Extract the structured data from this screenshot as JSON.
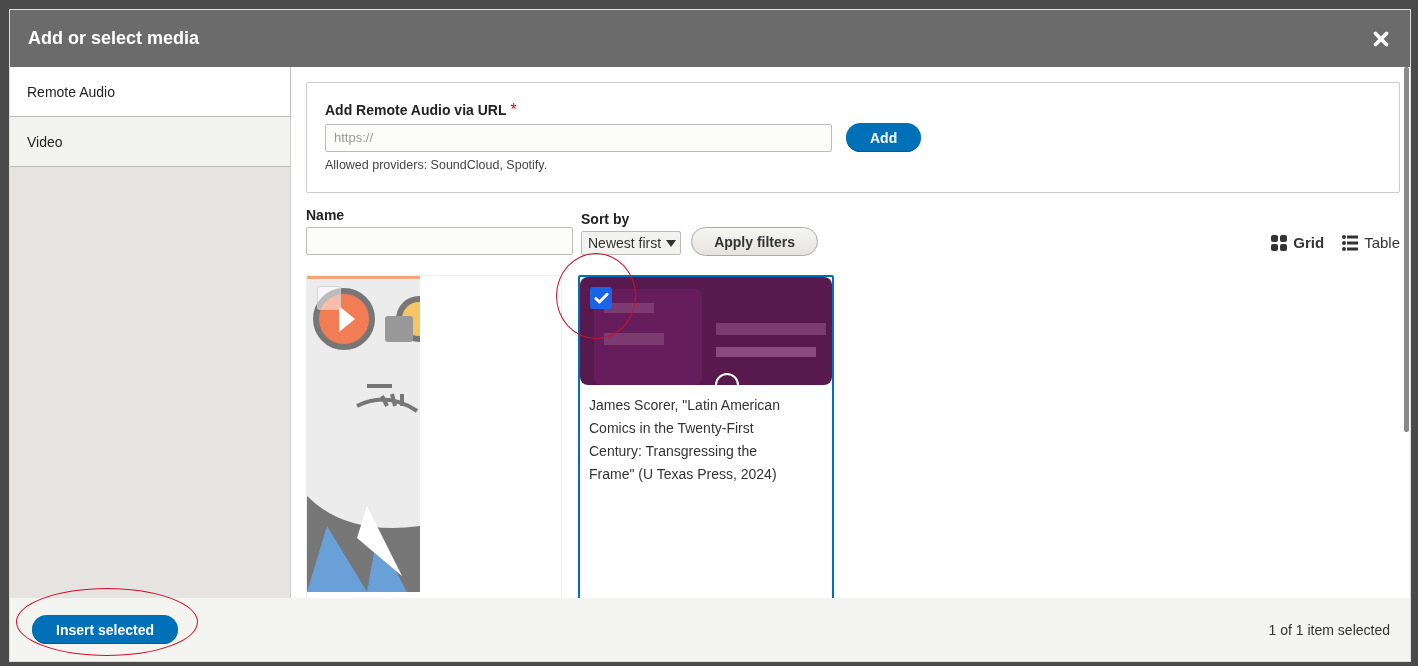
{
  "dialog": {
    "title": "Add or select media"
  },
  "tabs": [
    {
      "label": "Remote Audio",
      "selected": true
    },
    {
      "label": "Video",
      "selected": false
    }
  ],
  "url_form": {
    "label": "Add Remote Audio via URL",
    "required_mark": "*",
    "placeholder": "https://",
    "button": "Add",
    "help": "Allowed providers: SoundCloud, Spotify."
  },
  "filters": {
    "name_label": "Name",
    "sort_label": "Sort by",
    "sort_value": "Newest first",
    "apply_button": "Apply filters"
  },
  "views": [
    {
      "label": "Grid",
      "selected": true
    },
    {
      "label": "Table",
      "selected": false
    }
  ],
  "media": [
    {
      "kind": "cartoon",
      "checked": false
    },
    {
      "kind": "cover",
      "checked": true,
      "highlight": true,
      "caption": "James Scorer, \"Latin American Comics in the Twenty-First Century: Transgressing the Frame\" (U Texas Press, 2024)"
    }
  ],
  "footer": {
    "insert_button": "Insert selected",
    "insert_highlight": true,
    "status": "1 of 1 item selected"
  }
}
